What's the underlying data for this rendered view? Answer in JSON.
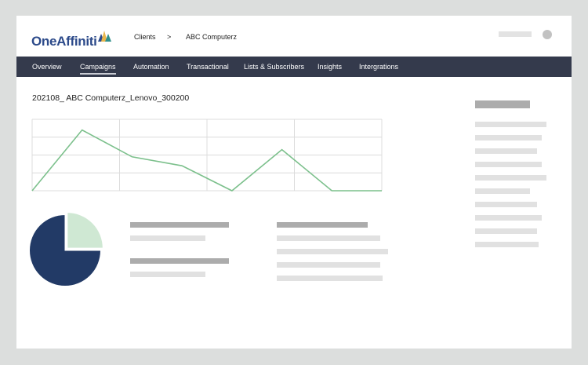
{
  "brand": {
    "name": "OneAffiniti",
    "colors": {
      "navy": "#223a66",
      "green": "#7cc08c",
      "nav_bg": "#343a4c"
    }
  },
  "breadcrumb": {
    "items": [
      "Clients",
      "ABC Computerz"
    ],
    "separator": ">"
  },
  "nav": {
    "items": [
      {
        "label": "Overview"
      },
      {
        "label": "Campaigns",
        "active": true
      },
      {
        "label": "Automation"
      },
      {
        "label": "Transactional"
      },
      {
        "label": "Lists & Subscribers"
      },
      {
        "label": "Insights"
      },
      {
        "label": "Intergrations"
      }
    ]
  },
  "page": {
    "title": "202108_ ABC Computerz_Lenovo_300200"
  },
  "chart_data": [
    {
      "type": "line",
      "x": [
        0,
        1,
        2,
        3,
        4,
        5,
        6,
        7
      ],
      "values": [
        0,
        3.4,
        1.9,
        1.4,
        0,
        2.3,
        0,
        0
      ],
      "ylim": [
        0,
        4
      ],
      "grid": true,
      "color": "#7cc08c"
    },
    {
      "type": "pie",
      "values": [
        75,
        25
      ],
      "colors": [
        "#223a66",
        "#cfe8d3"
      ],
      "exploded": [
        false,
        true
      ]
    }
  ]
}
